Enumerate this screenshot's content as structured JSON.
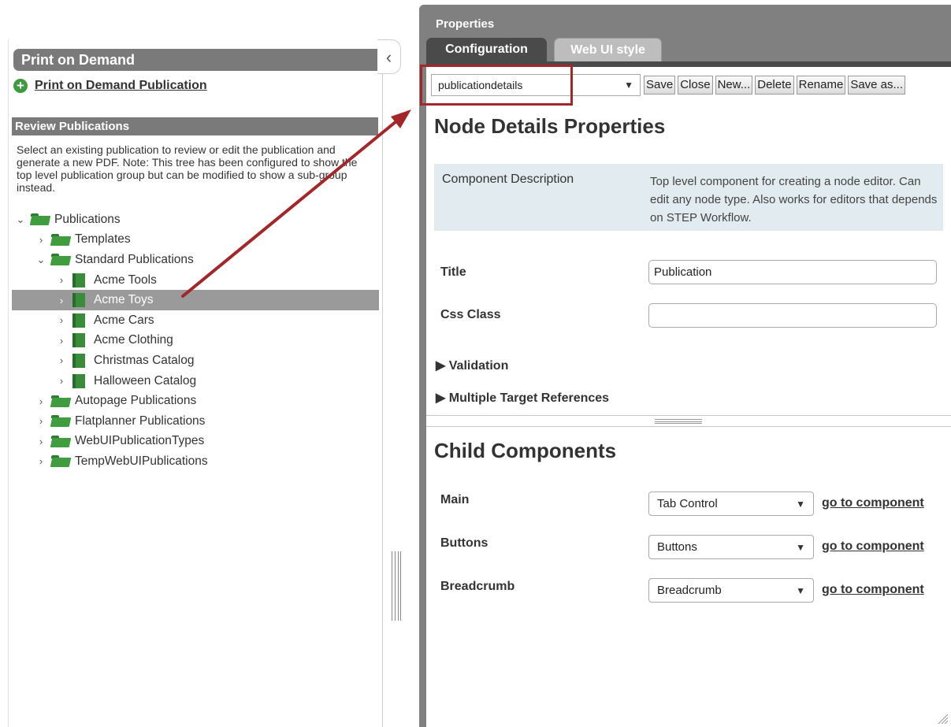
{
  "left_panel": {
    "header": "Print on Demand",
    "collapse_glyph": "‹",
    "pod_link": "Print on Demand Publication",
    "review_header": "Review Publications",
    "review_desc": "Select an existing publication to review or edit the publication and generate a new PDF. Note: This tree has been configured to show the top level publication group but can be modified to show a sub-group instead.",
    "tree": [
      {
        "label": "Publications",
        "icon": "folder-open-icon",
        "expanded": true,
        "level": 0
      },
      {
        "label": "Templates",
        "icon": "folder-icon",
        "expanded": false,
        "level": 1
      },
      {
        "label": "Standard Publications",
        "icon": "folder-open-icon",
        "expanded": true,
        "level": 1
      },
      {
        "label": "Acme Tools",
        "icon": "book-icon",
        "expanded": false,
        "level": 2
      },
      {
        "label": "Acme Toys",
        "icon": "book-icon",
        "expanded": false,
        "level": 2,
        "selected": true
      },
      {
        "label": "Acme Cars",
        "icon": "book-icon",
        "expanded": false,
        "level": 2
      },
      {
        "label": "Acme Clothing",
        "icon": "book-icon",
        "expanded": false,
        "level": 2
      },
      {
        "label": "Christmas Catalog",
        "icon": "book-icon",
        "expanded": false,
        "level": 2
      },
      {
        "label": "Halloween Catalog",
        "icon": "book-icon",
        "expanded": false,
        "level": 2
      },
      {
        "label": "Autopage Publications",
        "icon": "folder-icon",
        "expanded": false,
        "level": 1
      },
      {
        "label": "Flatplanner Publications",
        "icon": "folder-icon",
        "expanded": false,
        "level": 1
      },
      {
        "label": "WebUIPublicationTypes",
        "icon": "folder-icon",
        "expanded": false,
        "level": 1
      },
      {
        "label": "TempWebUIPublications",
        "icon": "folder-icon",
        "expanded": false,
        "level": 1
      }
    ]
  },
  "properties": {
    "title": "Properties",
    "tabs": [
      {
        "label": "Configuration",
        "active": true
      },
      {
        "label": "Web UI style",
        "active": false
      }
    ],
    "toolbar": {
      "component_select": "publicationdetails",
      "buttons": [
        "Save",
        "Close",
        "New...",
        "Delete",
        "Rename",
        "Save as..."
      ]
    },
    "node_details_title": "Node Details Properties",
    "component_description_label": "Component Description",
    "component_description_text": "Top level component for creating a node editor. Can edit any node type. Also works for editors that depends on STEP Workflow.",
    "fields": [
      {
        "label": "Title",
        "value": "Publication"
      },
      {
        "label": "Css Class",
        "value": ""
      }
    ],
    "expanders": [
      "Validation",
      "Multiple Target References"
    ],
    "child_components_title": "Child Components",
    "child_components": [
      {
        "label": "Main",
        "value": "Tab Control",
        "link": "go to component"
      },
      {
        "label": "Buttons",
        "value": "Buttons",
        "link": "go to component"
      },
      {
        "label": "Breadcrumb",
        "value": "Breadcrumb",
        "link": "go to component"
      }
    ]
  },
  "colors": {
    "header_gray": "#7a7a7a",
    "tab_dark": "#4a4a4a",
    "annotation_red": "#a3262a",
    "icon_green": "#3f9d3f",
    "description_bg": "#e2ebef"
  }
}
